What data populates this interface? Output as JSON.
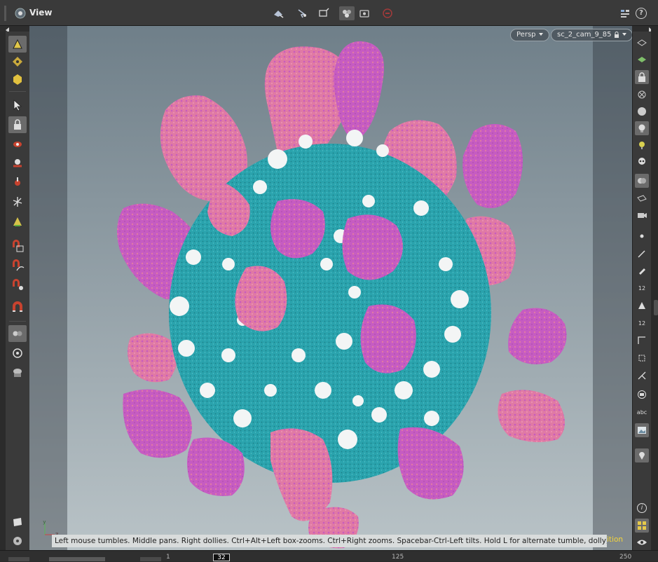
{
  "pane": {
    "title": "View",
    "icon": "eye-view-icon"
  },
  "top_toolbar": {
    "center_tools": [
      "select-mode-icon",
      "secure-selection-icon",
      "transform-handles-icon",
      "display-options-icon",
      "snapshot-icon",
      "stop-render-icon"
    ],
    "right_tools": [
      "pane-layout-icon",
      "help-icon"
    ],
    "help_label": "?"
  },
  "left_toolbar": {
    "tools": [
      "object-mode-icon",
      "points-mode-icon",
      "primitive-mode-icon",
      "select-arrow-icon",
      "lock-icon",
      "view-camera-icon",
      "render-region-icon",
      "handle-tool-icon",
      "pose-tool-icon",
      "brush-tool-icon",
      "magnet-snap-grid-icon",
      "magnet-snap-curve-icon",
      "magnet-snap-point-icon",
      "magnet-icon",
      "link-camera-icon",
      "snap-record-icon",
      "render-view-icon"
    ],
    "selected": [
      "object-mode-icon",
      "lock-icon",
      "link-camera-icon"
    ]
  },
  "viewport": {
    "camera_dropdown": "Persp",
    "camera_name": "sc_2_cam_9_85",
    "status_message": "Left mouse tumbles. Middle pans. Right dollies. Ctrl+Alt+Left box-zooms. Ctrl+Right zooms. Spacebar-Ctrl-Left tilts. Hold L for alternate tumble, dolly, and zoom.",
    "status_tail": "ition",
    "axis_labels": {
      "y": "y",
      "z": "z"
    },
    "colors": {
      "virus_body": "#2ba4ad",
      "spike_pink": "#e277a4",
      "spike_magenta": "#c45ac0",
      "white_blobs": "#f2f4f4",
      "background_top": "#6f7f89",
      "background_bottom": "#b9c3c7"
    }
  },
  "right_toolbar": {
    "tools": [
      "layers-icon",
      "ghost-icon",
      "lock-view-icon",
      "close-view-icon",
      "sphere-icon",
      "light-bulb-icon",
      "point-light-icon",
      "skull-icon",
      "cloud-icon",
      "camera-icon",
      "camera-small-icon",
      "dot-icon",
      "wand-icon",
      "pen-icon",
      "count-12-icon",
      "shader-icon",
      "count-12b-icon",
      "path-icon",
      "constraint-icon",
      "chain-icon",
      "frame-icon",
      "text-abc-icon",
      "image-icon",
      "pin-icon",
      "info-icon",
      "grid-icon",
      "eye-icon"
    ],
    "label_12": "12",
    "label_12b": "12",
    "label_abc": "abc",
    "label_info": "i"
  },
  "timeline": {
    "start": "1",
    "current_frame": "32",
    "mid": "125",
    "end": "250"
  }
}
